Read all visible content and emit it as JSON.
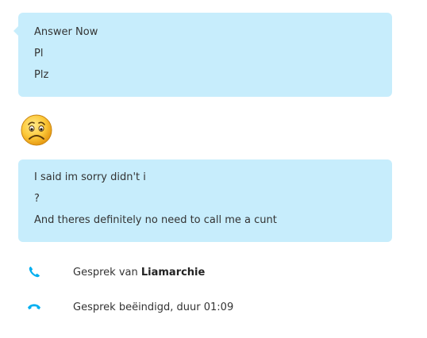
{
  "messages": {
    "bubble1": [
      "Answer Now",
      "Pl",
      "Plz"
    ],
    "emoji": "worried-face-icon",
    "bubble2": [
      "I said im sorry didn't i",
      "?",
      "And theres definitely no need to call me a cunt"
    ]
  },
  "call_log": {
    "incoming_prefix": "Gesprek van",
    "caller_name": "Liamarchie",
    "ended_text": "Gesprek beëindigd, duur 01:09"
  },
  "colors": {
    "bubble": "#c7edfc",
    "call_icon": "#00aff0",
    "text": "#333333"
  }
}
